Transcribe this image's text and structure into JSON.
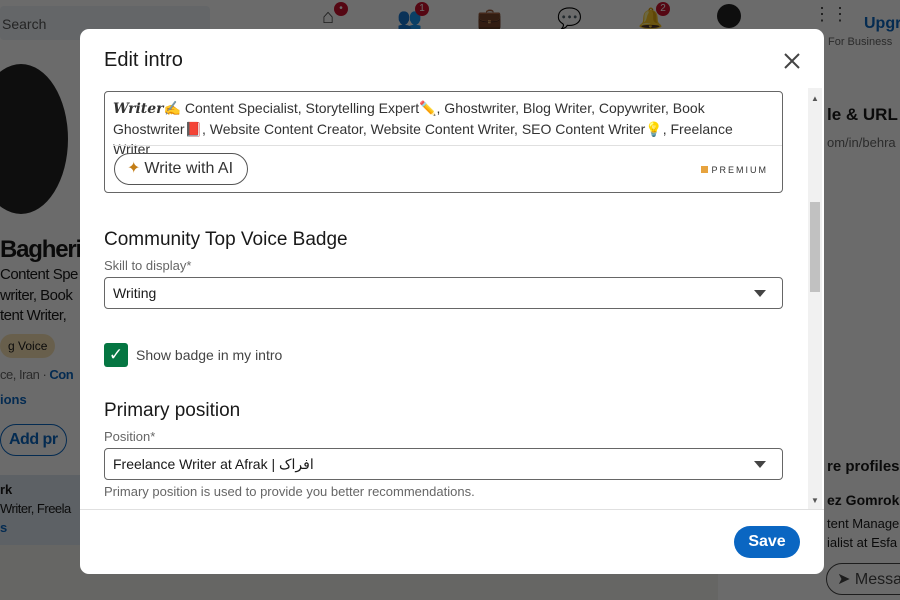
{
  "background": {
    "search_placeholder": "Search",
    "nav": [
      {
        "icon": "home-icon",
        "badge": ""
      },
      {
        "icon": "my-network-icon",
        "badge": "1"
      },
      {
        "icon": "jobs-icon",
        "badge": ""
      },
      {
        "icon": "messaging-icon",
        "badge": ""
      },
      {
        "icon": "notifications-icon",
        "badge": "2"
      }
    ],
    "for_business": "For Business",
    "upgrade": "Upgr",
    "profile_name": "Bagheri",
    "headline_lines": [
      "Content Spe",
      "writer, Book",
      "tent Writer,"
    ],
    "voice_badge": "g Voice",
    "location": "ce, Iran · ",
    "contact": "Con",
    "connections": "ions",
    "add_profile": "Add pr",
    "open_to_work": "rk",
    "open_to_work_desc": "Writer, Freela",
    "open_to_work_link": "s",
    "profile_url_title": "le & URL",
    "profile_url": "om/in/behra",
    "more_profiles": "re profiles",
    "person_name": "ez Gomrok",
    "person_lines": [
      "tent Manage",
      "ialist at Esfa"
    ],
    "message": "Message"
  },
  "modal": {
    "title": "Edit intro",
    "headline_value_bold": "Writer",
    "headline_value": "✍️ Content Specialist, Storytelling Expert✏️, Ghostwriter, Blog Writer, Copywriter, Book Ghostwriter📕, Website Content Creator, Website Content Writer, SEO Content Writer💡, Freelance Writer",
    "write_ai": "Write with AI",
    "premium": "PREMIUM",
    "badge_section": "Community Top Voice Badge",
    "skill_label": "Skill to display*",
    "skill_value": "Writing",
    "show_badge_label": "Show badge in my intro",
    "show_badge_checked": true,
    "position_section": "Primary position",
    "position_label": "Position*",
    "position_value": "Freelance Writer at Afrak | افراک",
    "position_help": "Primary position is used to provide you better recommendations.",
    "save": "Save"
  },
  "colors": {
    "accent": "#0a66c2",
    "checkbox": "#057642",
    "premium": "#e7a33e"
  }
}
